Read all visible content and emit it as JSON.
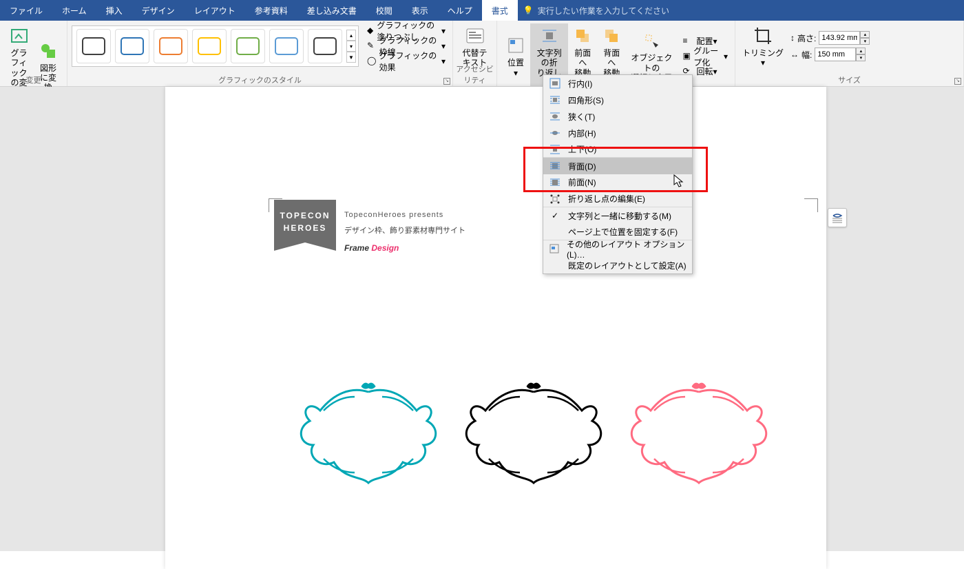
{
  "tabs": {
    "items": [
      "ファイル",
      "ホーム",
      "挿入",
      "デザイン",
      "レイアウト",
      "参考資料",
      "差し込み文書",
      "校閲",
      "表示",
      "ヘルプ",
      "書式"
    ],
    "active": 10,
    "search_placeholder": "実行したい作業を入力してください"
  },
  "ribbon": {
    "change": {
      "label": "変更",
      "btn1": "グラフィック\nの変更",
      "btn2": "図形\nに変換"
    },
    "styles": {
      "label": "グラフィックのスタイル",
      "colors": [
        "#404040",
        "#2e75b6",
        "#ed7d31",
        "#ffc000",
        "#70ad47",
        "#5b9bd5",
        "#404040"
      ],
      "fill": "グラフィックの塗りつぶし",
      "outline": "グラフィックの枠線",
      "effects": "グラフィックの効果"
    },
    "acc": {
      "label": "アクセシビリティ",
      "btn": "代替テ\nキスト"
    },
    "arrange": {
      "pos": "位置",
      "wrap": "文字列の折\nり返し",
      "front": "前面へ\n移動",
      "back": "背面へ\n移動",
      "select": "オブジェクトの\n選択と表示",
      "align": "配置",
      "group": "グループ化",
      "rotate": "回転"
    },
    "size": {
      "label": "サイズ",
      "trim": "トリミング",
      "h_lbl": "高さ:",
      "h_val": "143.92 mm",
      "w_lbl": "幅:",
      "w_val": "150 mm"
    }
  },
  "dropdown": {
    "items": [
      {
        "label": "行内(I)",
        "icon": "inline"
      },
      {
        "label": "四角形(S)",
        "icon": "square"
      },
      {
        "label": "狭く(T)",
        "icon": "tight"
      },
      {
        "label": "内部(H)",
        "icon": "through"
      },
      {
        "label": "上下(O)",
        "icon": "topbot",
        "sep": true
      },
      {
        "label": "背面(D)",
        "icon": "behind",
        "hover": true
      },
      {
        "label": "前面(N)",
        "icon": "front",
        "sep": true
      },
      {
        "label": "折り返し点の編集(E)",
        "icon": "edit",
        "sep": true
      },
      {
        "label": "文字列と一緒に移動する(M)",
        "check": true
      },
      {
        "label": "ページ上で位置を固定する(F)",
        "sep": true
      },
      {
        "label": "その他のレイアウト オプション(L)…",
        "icon": "more"
      },
      {
        "label": "既定のレイアウトとして設定(A)"
      }
    ]
  },
  "doc": {
    "badge_l1": "TOPECON",
    "badge_l2": "HEROES",
    "present": "TopeconHeroes presents",
    "sub": "デザイン枠、飾り罫素材専門サイト",
    "title_a": "Frame ",
    "title_b": "Design",
    "frame_colors": [
      "#00a7b5",
      "#000000",
      "#ff6b81"
    ]
  }
}
